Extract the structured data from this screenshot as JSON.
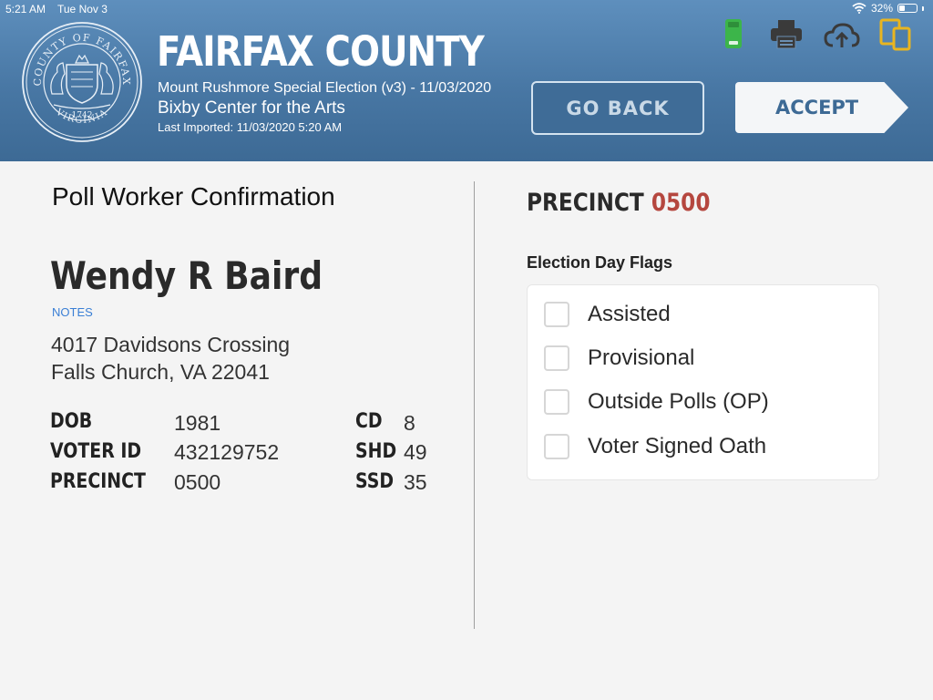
{
  "status_bar": {
    "time": "5:21 AM",
    "date": "Tue Nov 3",
    "battery": "32%",
    "battery_level": 0.32
  },
  "header": {
    "seal": {
      "top_text": "COUNTY OF FAIRFAX",
      "bottom_text": "VIRGINIA",
      "year": "1742"
    },
    "title": "FAIRFAX COUNTY",
    "election": "Mount Rushmore Special Election (v3) - 11/03/2020",
    "location": "Bixby Center for the Arts",
    "last_imported": "Last Imported: 11/03/2020 5:20 AM",
    "go_back_label": "GO BACK",
    "accept_label": "ACCEPT",
    "icons": [
      "usb-drive-icon",
      "printer-icon",
      "cloud-upload-icon",
      "devices-icon"
    ],
    "colors": {
      "usb": "#3cb54a",
      "devices": "#e8b520",
      "icons": "#3a3a3a"
    }
  },
  "voter_panel": {
    "title": "Poll Worker Confirmation",
    "name": "Wendy R Baird",
    "notes_label": "NOTES",
    "address_line1": "4017 Davidsons Crossing",
    "address_line2": "Falls Church, VA 22041",
    "details": {
      "dob_label": "DOB",
      "dob": "1981",
      "voter_id_label": "VOTER ID",
      "voter_id": "432129752",
      "precinct_label": "PRECINCT",
      "precinct": "0500",
      "cd_label": "CD",
      "cd": "8",
      "shd_label": "SHD",
      "shd": "49",
      "ssd_label": "SSD",
      "ssd": "35"
    }
  },
  "precinct_panel": {
    "precinct_label": "PRECINCT",
    "precinct_number": "0500",
    "flags_title": "Election Day Flags",
    "flags": [
      {
        "label": "Assisted",
        "checked": false
      },
      {
        "label": "Provisional",
        "checked": false
      },
      {
        "label": "Outside Polls (OP)",
        "checked": false
      },
      {
        "label": "Voter Signed Oath",
        "checked": false
      }
    ]
  }
}
